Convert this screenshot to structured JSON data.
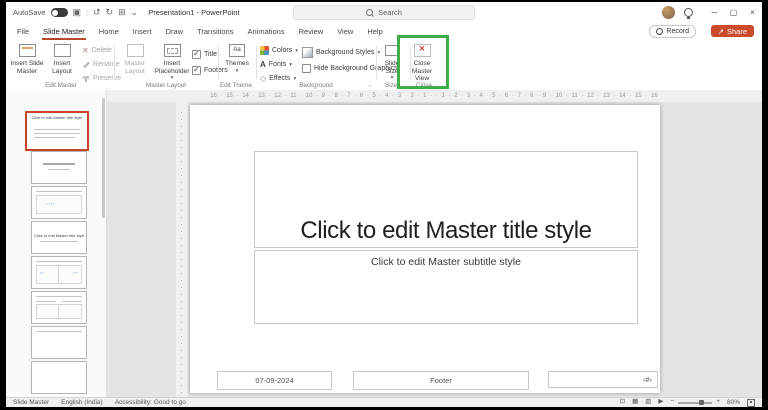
{
  "titlebar": {
    "autosave_label": "AutoSave",
    "doc_title": "Presentation1 - PowerPoint",
    "search_placeholder": "Search"
  },
  "tabs": {
    "items": [
      "File",
      "Slide Master",
      "Home",
      "Insert",
      "Draw",
      "Transitions",
      "Animations",
      "Review",
      "View",
      "Help"
    ],
    "active": "Slide Master",
    "record_label": "Record",
    "share_label": "Share"
  },
  "ribbon": {
    "edit_master": {
      "label": "Edit Master",
      "insert_slide_master": "Insert Slide Master",
      "insert_layout": "Insert Layout",
      "delete": "Delete",
      "rename": "Rename",
      "preserve": "Preserve"
    },
    "master_layout": {
      "label": "Master Layout",
      "master_layout": "Master Layout",
      "insert_placeholder": "Insert Placeholder",
      "title_checkbox": "Title",
      "footers_checkbox": "Footers",
      "title_checked": true,
      "footers_checked": true
    },
    "edit_theme": {
      "label": "Edit Theme",
      "themes": "Themes"
    },
    "background": {
      "label": "Background",
      "colors": "Colors",
      "fonts": "Fonts",
      "effects": "Effects",
      "background_styles": "Background Styles",
      "hide_background_graphics": "Hide Background Graphics",
      "hide_background_graphics_checked": false
    },
    "size": {
      "label": "Size",
      "slide_size": "Slide Size"
    },
    "close": {
      "label": "Close",
      "close_master_view": "Close Master View"
    }
  },
  "ruler": {
    "horizontal": "16 · 15 · 14 · 13 · 12 · 11 · 10 · 9 · 8 · 7 · 6 · 5 · 4 · 3 · 2 · 1 · · 1 · 2 · 3 · 4 · 5 · 6 · 7 · 8 · 9 · 10 · 11 · 12 · 13 · 14 · 15 · 16"
  },
  "slide": {
    "title_placeholder": "Click to edit Master title style",
    "subtitle_placeholder": "Click to edit Master subtitle style",
    "date": "07-09-2024",
    "footer": "Footer",
    "slide_number": "‹#›"
  },
  "statusbar": {
    "view_label": "Slide Master",
    "language": "English (India)",
    "accessibility": "Accessibility: Good to go",
    "zoom_percent": "80%"
  },
  "colors": {
    "accent": "#B7472A",
    "share_button": "#CB4A2C",
    "selected_thumbnail_border": "#C4442A",
    "annotation_highlight": "#3FAE49"
  }
}
